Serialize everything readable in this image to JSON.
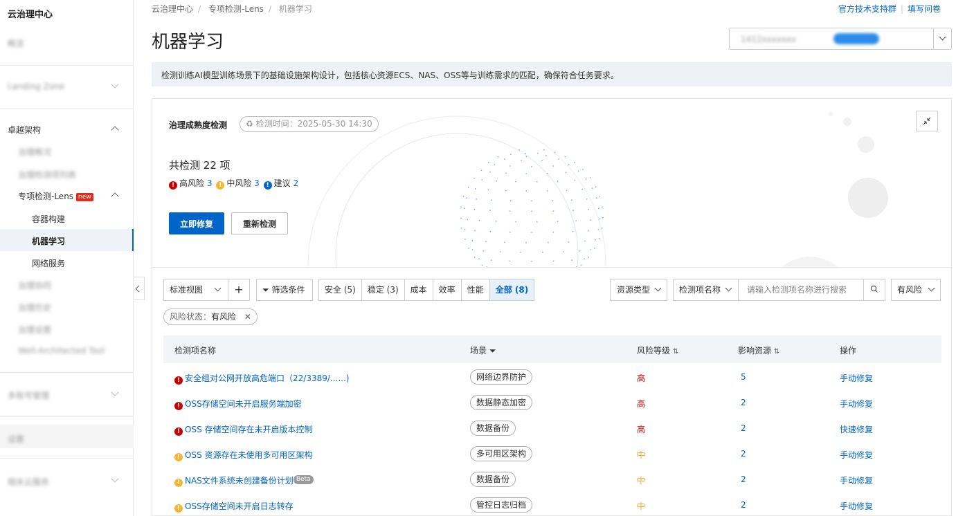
{
  "sidebar": {
    "title": "云治理中心",
    "items": [
      {
        "label": "概览",
        "blurred": true
      },
      {
        "label": "Landing Zone",
        "blurred": true
      },
      {
        "label": "卓越架构",
        "blurred": false
      },
      {
        "label": "治理概况",
        "blurred": true
      },
      {
        "label": "治理检测项列表",
        "blurred": true
      },
      {
        "label": "专项检测-Lens",
        "badge": "new"
      },
      {
        "label": "容器构建"
      },
      {
        "label": "机器学习"
      },
      {
        "label": "网络服务"
      },
      {
        "label": "治理协同",
        "blurred": true
      },
      {
        "label": "治理历史",
        "blurred": true
      },
      {
        "label": "治理设置",
        "blurred": true
      },
      {
        "label": "Well-Architected Tool",
        "blurred": true
      },
      {
        "label": "多账号管理",
        "blurred": true
      },
      {
        "label": "设置",
        "blurred": true
      },
      {
        "label": "相关云服务",
        "blurred": true
      }
    ]
  },
  "breadcrumb": [
    "云治理中心",
    "专项检测-Lens",
    "机器学习"
  ],
  "top_links": [
    "官方技术支持群",
    "填写问卷"
  ],
  "page_title": "机器学习",
  "account_selector": {
    "account": "1412xxxxxxx",
    "tag": "管理账号"
  },
  "description": "检测训练AI模型训练场景下的基础设施架构设计，包括核心资源ECS、NAS、OSS等与训练需求的匹配，确保符合任务要求。",
  "summary": {
    "title": "治理成熟度检测",
    "time_label": "检测时间：2025-05-30 14:30",
    "total_prefix": "共检测",
    "total_num": "22",
    "total_suffix": "项",
    "high_label": "高风险",
    "high_num": "3",
    "mid_label": "中风险",
    "mid_num": "3",
    "sug_label": "建议",
    "sug_num": "2",
    "fix_button": "立即修复",
    "recheck_button": "重新检测"
  },
  "toolbar": {
    "view_select": "标准视图",
    "add": "+",
    "filter_button": "筛选条件",
    "segments": [
      "安全 (5)",
      "稳定 (3)",
      "成本",
      "效率",
      "性能",
      "全部 (8)"
    ],
    "active_segment": 5,
    "resource_type": "资源类型",
    "search_field": "检测项名称",
    "search_placeholder": "请输入检测项名称进行搜索",
    "risk_select": "有风险"
  },
  "active_filter": {
    "label": "风险状态：",
    "value": "有风险"
  },
  "table": {
    "headers": [
      "检测项名称",
      "场景",
      "风险等级",
      "影响资源",
      "操作"
    ],
    "rows": [
      {
        "level_icon": "red",
        "name": "安全组对公网开放高危端口（22/3389/......)",
        "scene": "网络边界防护",
        "risk": "高",
        "resources": "5",
        "action": "手动修复"
      },
      {
        "level_icon": "red",
        "name": "OSS存储空间未开启服务端加密",
        "scene": "数据静态加密",
        "risk": "高",
        "resources": "2",
        "action": "手动修复"
      },
      {
        "level_icon": "red",
        "name": "OSS 存储空间存在未开启版本控制",
        "scene": "数据备份",
        "risk": "高",
        "resources": "2",
        "action": "快速修复"
      },
      {
        "level_icon": "yellow",
        "name": "OSS 资源存在未使用多可用区架构",
        "scene": "多可用区架构",
        "risk": "中",
        "resources": "2",
        "action": "手动修复"
      },
      {
        "level_icon": "yellow",
        "name": "NAS文件系统未创建备份计划",
        "beta": "Beta",
        "scene": "数据备份",
        "risk": "中",
        "resources": "2",
        "action": "手动修复"
      },
      {
        "level_icon": "yellow",
        "name": "OSS存储空间未开启日志转存",
        "scene": "管控日志归档",
        "risk": "中",
        "resources": "2",
        "action": "手动修复"
      }
    ]
  },
  "colors": {
    "primary": "#0064c8",
    "high": "#c80000",
    "mid": "#f5a623"
  }
}
